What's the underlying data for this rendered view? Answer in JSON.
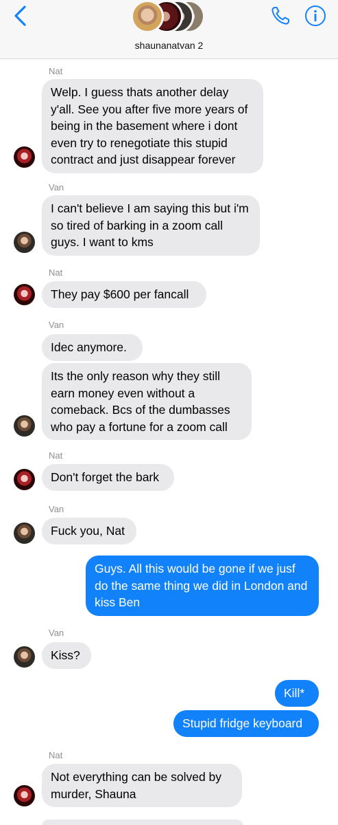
{
  "header": {
    "group_name": "shaunanatvan 2",
    "back_icon": "chevron-left-icon",
    "call_icon": "phone-icon",
    "info_icon": "info-icon",
    "accent_color": "#1282fb"
  },
  "messages": [
    {
      "sender": "Nat",
      "text": "Welp. I guess thats another delay y'all. See you after five more years of being in the basement where i dont even try to renegotiate this stupid contract and just disappear forever"
    },
    {
      "sender": "Van",
      "text": "I can't believe I am saying this but i'm so tired of barking in a zoom call guys. I want to kms"
    },
    {
      "sender": "Nat",
      "text": "They pay $600 per fancall"
    },
    {
      "sender": "Van",
      "text": "Idec anymore."
    },
    {
      "sender": "Van",
      "text": "Its the only reason why they still earn money even without a comeback. Bcs of the dumbasses who pay a fortune for a zoom call"
    },
    {
      "sender": "Nat",
      "text": "Don't forget the bark"
    },
    {
      "sender": "Van",
      "text": "Fuck you, Nat"
    },
    {
      "sender": "me",
      "text": "Guys. All this would be gone if we jusf do the same thing we did in London and kiss Ben"
    },
    {
      "sender": "Van",
      "text": "Kiss?"
    },
    {
      "sender": "me",
      "text": "Kill*"
    },
    {
      "sender": "me",
      "text": "Stupid fridge keyboard"
    },
    {
      "sender": "Nat",
      "text": "Not everything can be solved by murder, Shauna"
    }
  ]
}
